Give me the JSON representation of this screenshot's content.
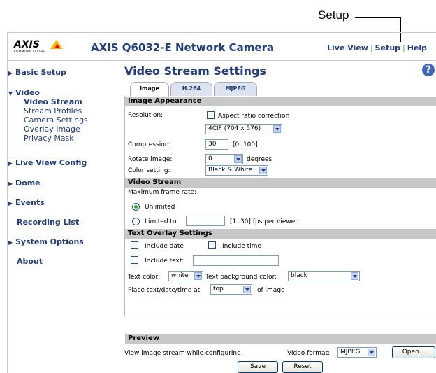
{
  "callout": {
    "label": "Setup"
  },
  "header": {
    "logo": "AXIS",
    "logo_sub": "COMMUNICATIONS",
    "title": "AXIS Q6032-E Network Camera",
    "nav": {
      "live_view": "Live View",
      "setup": "Setup",
      "help": "Help",
      "sep": "|"
    }
  },
  "sidebar": {
    "basic_setup": "Basic Setup",
    "video": "Video",
    "video_items": [
      "Video Stream",
      "Stream Profiles",
      "Camera Settings",
      "Overlay Image",
      "Privacy Mask"
    ],
    "live_view_config": "Live View Config",
    "dome": "Dome",
    "events": "Events",
    "recording_list": "Recording List",
    "system_options": "System Options",
    "about": "About"
  },
  "main": {
    "title": "Video Stream Settings",
    "help_icon": "?",
    "tabs": [
      {
        "label": "Image",
        "active": true
      },
      {
        "label": "H.264",
        "active": false
      },
      {
        "label": "MJPEG",
        "active": false
      }
    ],
    "image_appearance": {
      "heading": "Image Appearance",
      "resolution_label": "Resolution:",
      "aspect_label": "Aspect ratio correction",
      "aspect_checked": false,
      "resolution_value": "4CIF (704 x 576)",
      "compression_label": "Compression:",
      "compression_value": "30",
      "compression_range": "[0..100]",
      "rotate_label": "Rotate image:",
      "rotate_value": "0",
      "rotate_unit": "degrees",
      "color_label": "Color setting:",
      "color_value": "Black & White"
    },
    "video_stream": {
      "heading": "Video Stream",
      "max_frame_label": "Maximum frame rate:",
      "unlimited_label": "Unlimited",
      "unlimited_selected": true,
      "limited_label": "Limited to",
      "limited_value": "",
      "limited_hint": "[1..30] fps per viewer"
    },
    "text_overlay": {
      "heading": "Text Overlay Settings",
      "include_date": "Include date",
      "include_time": "Include time",
      "include_text": "Include text:",
      "include_text_value": "",
      "text_color_label": "Text color:",
      "text_color_value": "white",
      "bg_color_label": "Text background color:",
      "bg_color_value": "black",
      "place_label": "Place text/date/time at",
      "place_value": "top",
      "place_suffix": "of image"
    }
  },
  "preview": {
    "heading": "Preview",
    "desc": "View image stream while configuring.",
    "format_label": "Video format:",
    "format_value": "MJPEG",
    "open_button": "Open..."
  },
  "actions": {
    "save": "Save",
    "reset": "Reset"
  },
  "colors": {
    "brand_blue": "#233e78",
    "section_gray": "#c8c8c8",
    "logo_yellow": "#f6b600"
  }
}
